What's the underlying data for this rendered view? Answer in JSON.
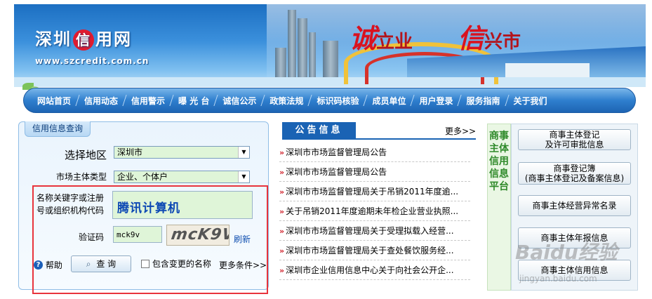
{
  "banner": {
    "logo_part1": "深圳",
    "logo_mark": "信",
    "logo_part2": "用网",
    "url": "www.szcredit.com.cn",
    "slogan1_big": "诚",
    "slogan1_rest": "立业",
    "slogan2_big": "信",
    "slogan2_rest": "兴市"
  },
  "nav": {
    "items": [
      "网站首页",
      "信用动态",
      "信用警示",
      "曝 光 台",
      "诚信公示",
      "政策法规",
      "标识码核验",
      "成员单位",
      "用户登录",
      "服务指南",
      "关于我们"
    ]
  },
  "query": {
    "tab_title": "信用信息查询",
    "region_label": "选择地区",
    "region_value": "深圳市",
    "type_label": "市场主体类型",
    "type_value": "企业、个体户",
    "keyword_label": "名称关键字或注册号或组织机构代码",
    "keyword_value": "腾讯计算机",
    "captcha_label": "验证码",
    "captcha_value": "mck9v",
    "captcha_image_text": "mcK9V",
    "refresh_label": "刷新",
    "help_label": "帮助",
    "search_label": "查 询",
    "include_changed_label": "包含变更的名称",
    "more_conditions_label": "更多条件>>"
  },
  "notices": {
    "tab_title": "公告信息",
    "more_label": "更多>>",
    "items": [
      "深圳市市场监督管理局公告",
      "深圳市市场监督管理局公告",
      "深圳市市场监督管理局关于吊销2011年度逾...",
      "关于吊销2011年度逾期未年检企业营业执照...",
      "深圳市市场监督管理局关于受理拟载入经营...",
      "深圳市市场监督管理局关于查处餐饮服务经...",
      "深圳市企业信用信息中心关于向社会公开企..."
    ],
    "bullet": "»"
  },
  "platform": {
    "vertical_title": "商事主体信用信息平台",
    "buttons": [
      {
        "line1": "商事主体登记",
        "line2": "及许可审批信息"
      },
      {
        "line1": "商事登记簿",
        "line2": "(商事主体登记及备案信息)"
      },
      {
        "line1": "商事主体经营异常名录",
        "line2": ""
      },
      {
        "line1": "商事主体年报信息",
        "line2": ""
      },
      {
        "line1": "商事主体信用信息",
        "line2": ""
      }
    ]
  },
  "watermark": {
    "brand": "Baidu经验",
    "url": "jingyan.baidu.com"
  }
}
